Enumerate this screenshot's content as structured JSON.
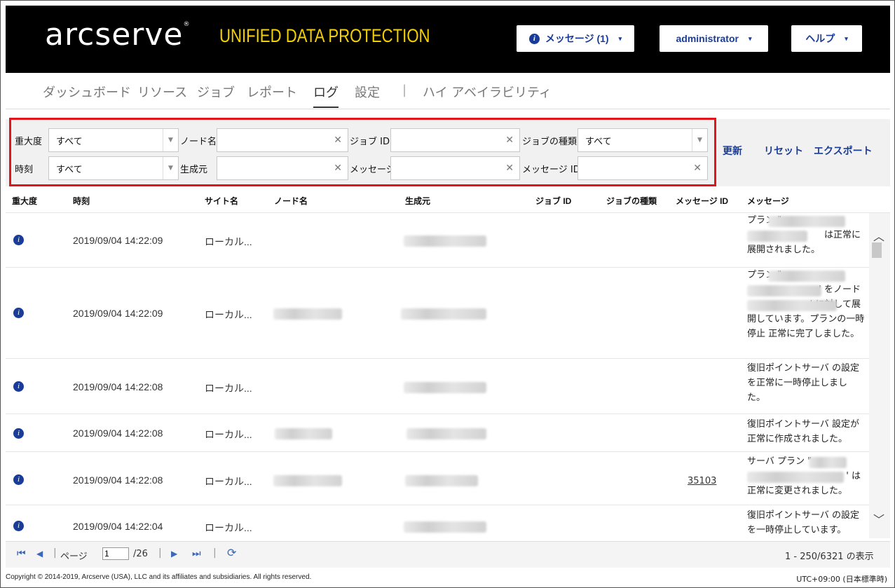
{
  "header": {
    "brand": "arcserve",
    "brand_reg": "®",
    "product": "UNIFIED DATA PROTECTION",
    "messages_button": "メッセージ (1)",
    "user_button": "administrator",
    "help_button": "ヘルプ",
    "caret": "▾"
  },
  "nav": {
    "items": [
      "ダッシュボード",
      "リソース",
      "ジョブ",
      "レポート",
      "ログ",
      "設定",
      "ハイ アベイラビリティ"
    ],
    "separator": "|"
  },
  "filters": {
    "severity_label": "重大度",
    "severity_value": "すべて",
    "time_label": "時刻",
    "time_value": "すべて",
    "node_label": "ノード名",
    "node_value": "",
    "generated_label": "生成元",
    "generated_value": "",
    "job_id_label": "ジョブ ID",
    "job_id_value": "",
    "message_label": "メッセージ",
    "message_value": "",
    "job_type_label": "ジョブの種類",
    "job_type_value": "すべて",
    "message_id_label": "メッセージ ID",
    "message_id_value": "",
    "clear": "✕",
    "refresh": "更新",
    "reset": "リセット",
    "export": "エクスポート"
  },
  "table": {
    "columns": [
      "重大度",
      "時刻",
      "サイト名",
      "ノード名",
      "生成元",
      "ジョブ ID",
      "ジョブの種類",
      "メッセージ ID",
      "メッセージ"
    ],
    "rows": [
      {
        "time": "2019/09/04 14:22:09",
        "site": "ローカル...",
        "message_id": "",
        "msg": [
          "プラン \"",
          "",
          "は正常に",
          "展開されました。"
        ]
      },
      {
        "time": "2019/09/04 14:22:09",
        "site": "ローカル...",
        "message_id": "",
        "msg": [
          "プラン \"",
          "' をノード",
          "' に対して展",
          "開しています。プランの一時",
          "停止 正常に完了しました。"
        ]
      },
      {
        "time": "2019/09/04 14:22:08",
        "site": "ローカル...",
        "message_id": "",
        "msg": [
          "復旧ポイントサーバ の設定",
          "を正常に一時停止しまし",
          "た。"
        ]
      },
      {
        "time": "2019/09/04 14:22:08",
        "site": "ローカル...",
        "message_id": "",
        "msg": [
          "復旧ポイントサーバ 設定が",
          "正常に作成されました。"
        ]
      },
      {
        "time": "2019/09/04 14:22:08",
        "site": "ローカル...",
        "message_id": "35103",
        "msg": [
          "サーバ プラン \"",
          "' は",
          "正常に変更されました。"
        ]
      },
      {
        "time": "2019/09/04 14:22:04",
        "site": "ローカル...",
        "message_id": "",
        "msg": [
          "復旧ポイントサーバ の設定",
          "を一時停止しています。"
        ]
      }
    ]
  },
  "pager": {
    "page_label": "ページ",
    "page_value": "1",
    "total_pages": "/26",
    "summary": "1 - 250/6321 の表示"
  },
  "footer": {
    "copyright": "Copyright © 2014-2019, Arcserve (USA), LLC and its affiliates and subsidiaries. All rights reserved.",
    "timezone": "UTC+09:00 (日本標準時)"
  }
}
